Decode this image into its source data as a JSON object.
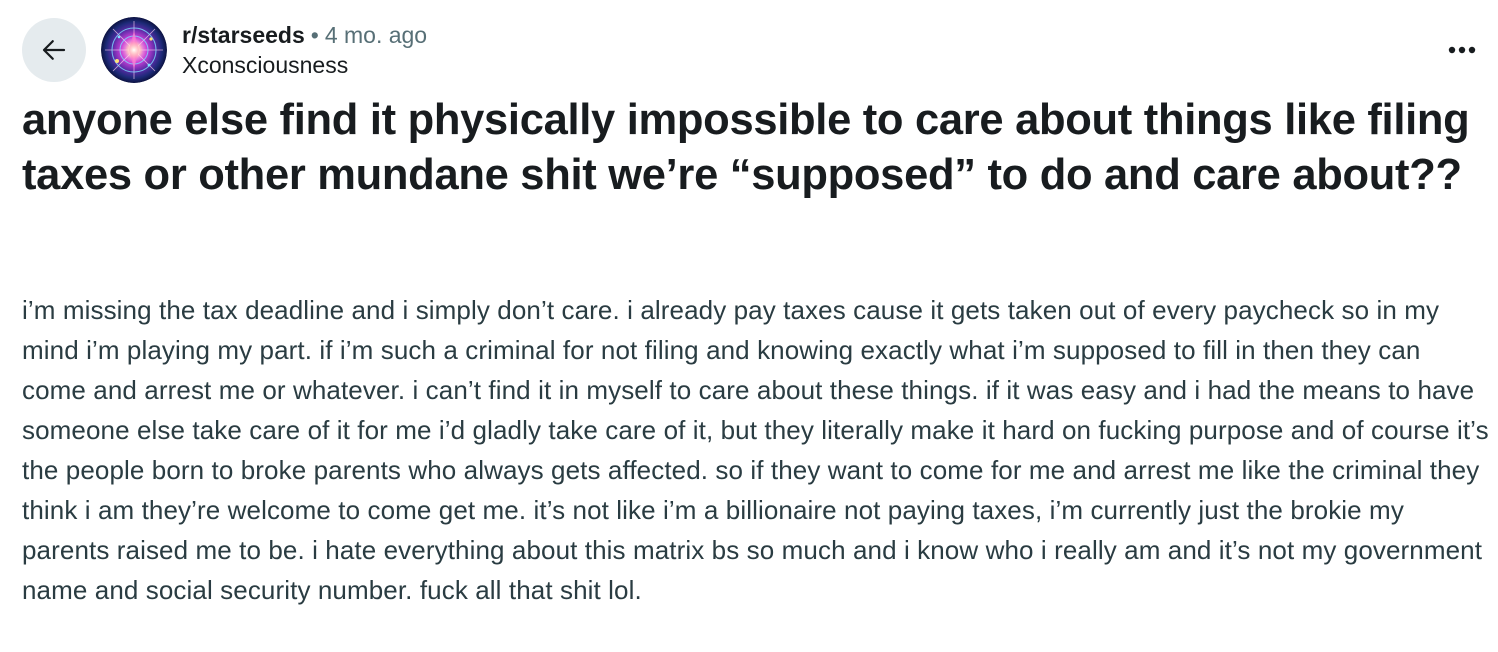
{
  "post": {
    "subreddit": "r/starseeds",
    "separator": "•",
    "time_ago": "4 mo. ago",
    "author": "Xconsciousness",
    "title": "anyone else find it physically impossible to care about things like filing taxes or other mundane shit we’re “supposed” to do and care about??",
    "body": "i’m missing the tax deadline and i simply don’t care. i already pay taxes cause it gets taken out of every paycheck so in my mind i’m playing my part. if i’m such a criminal for not filing and knowing exactly what i’m supposed to fill in then they can come and arrest me or whatever. i can’t find it in myself to care about these things. if it was easy and i had the means to have someone else take care of it for me i’d gladly take care of it, but they literally make it hard on fucking purpose and of course it’s the people born to broke parents who always gets affected. so if they want to come for me and arrest me like the criminal they think i am they’re welcome to come get me. it’s not like i’m a billionaire not paying taxes, i’m currently just the brokie my parents raised me to be. i hate everything about this matrix bs so much and i know who i really am and it’s not my government name and social security number. fuck all that shit lol."
  },
  "icons": {
    "back": "back-arrow-icon",
    "more": "more-options-icon",
    "avatar": "subreddit-avatar"
  },
  "colors": {
    "back_button_bg": "#e5ebee",
    "text_primary": "#181c1f",
    "text_secondary": "#576f76",
    "body_text": "#2a3c42"
  }
}
